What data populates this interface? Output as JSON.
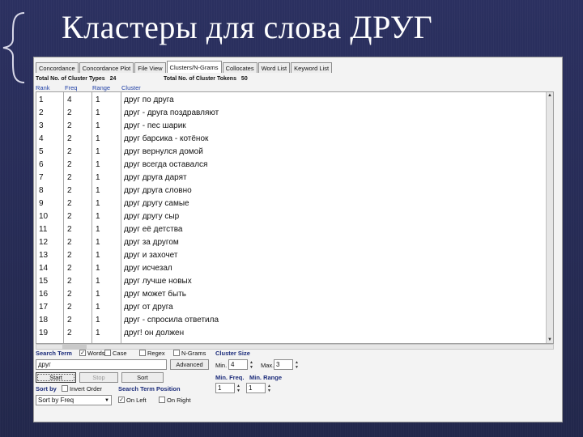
{
  "slide": {
    "title": "Кластеры для слова ДРУГ"
  },
  "tabs": [
    "Concordance",
    "Concordance Plot",
    "File View",
    "Clusters/N-Grams",
    "Collocates",
    "Word List",
    "Keyword List"
  ],
  "info": {
    "types_label": "Total No. of Cluster Types",
    "types_value": "24",
    "tokens_label": "Total No. of Cluster Tokens",
    "tokens_value": "50"
  },
  "columns": [
    "Rank",
    "Freq",
    "Range",
    "Cluster"
  ],
  "rows": [
    [
      "1",
      "4",
      "1",
      "друг по друга"
    ],
    [
      "2",
      "2",
      "1",
      "друг - друга поздравляют"
    ],
    [
      "3",
      "2",
      "1",
      "друг - пес шарик"
    ],
    [
      "4",
      "2",
      "1",
      "друг барсика - котёнок"
    ],
    [
      "5",
      "2",
      "1",
      "друг вернулся домой"
    ],
    [
      "6",
      "2",
      "1",
      "друг всегда оставался"
    ],
    [
      "7",
      "2",
      "1",
      "друг друга дарят"
    ],
    [
      "8",
      "2",
      "1",
      "друг друга словно"
    ],
    [
      "9",
      "2",
      "1",
      "друг другу самые"
    ],
    [
      "10",
      "2",
      "1",
      "друг другу сыр"
    ],
    [
      "11",
      "2",
      "1",
      "друг её детства"
    ],
    [
      "12",
      "2",
      "1",
      "друг за другом"
    ],
    [
      "13",
      "2",
      "1",
      "друг и захочет"
    ],
    [
      "14",
      "2",
      "1",
      "друг исчезал"
    ],
    [
      "15",
      "2",
      "1",
      "друг лучше новых"
    ],
    [
      "16",
      "2",
      "1",
      "друг может быть"
    ],
    [
      "17",
      "2",
      "1",
      "друг от друга"
    ],
    [
      "18",
      "2",
      "1",
      "друг - спросила ответила"
    ],
    [
      "19",
      "2",
      "1",
      "друг! он должен"
    ]
  ],
  "controls": {
    "search_term_label": "Search Term",
    "words_label": "Words",
    "case_label": "Case",
    "regex_label": "Regex",
    "ngrams_label": "N-Grams",
    "search_value": "друг",
    "advanced_label": "Advanced",
    "start_label": "Start",
    "stop_label": "Stop",
    "sort_label": "Sort",
    "sort_by_label": "Sort by",
    "invert_order_label": "Invert Order",
    "sort_select_value": "Sort by Freq",
    "position_label": "Search Term Position",
    "on_left_label": "On Left",
    "on_right_label": "On Right",
    "cluster_size_label": "Cluster Size",
    "min_label": "Min.",
    "min_value": "4",
    "max_label": "Max.",
    "max_value": "3",
    "min_freq_label": "Min. Freq.",
    "min_freq_value": "1",
    "min_range_label": "Min. Range",
    "min_range_value": "1"
  },
  "colors": {
    "background": "#262b52",
    "header_blue": "#1f3fa6"
  },
  "icons": [
    "bracket-decoration",
    "check-icon",
    "spin-arrows-icon",
    "dropdown-arrow-icon"
  ]
}
